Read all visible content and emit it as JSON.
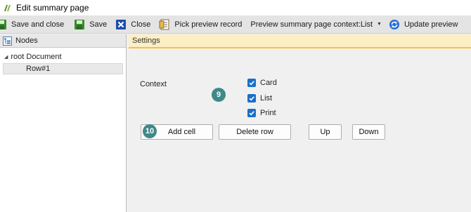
{
  "window": {
    "title": "Edit summary page"
  },
  "toolbar": {
    "save_and_close": "Save and close",
    "save": "Save",
    "close": "Close",
    "pick_preview_record": "Pick preview record",
    "preview_context": "Preview summary page context:List",
    "update_preview": "Update preview"
  },
  "nodes": {
    "header": "Nodes",
    "root_label": "root Document",
    "child_label": "Row#1"
  },
  "settings": {
    "header": "Settings",
    "context_label": "Context",
    "checkboxes": [
      {
        "label": "Card",
        "checked": true
      },
      {
        "label": "List",
        "checked": true
      },
      {
        "label": "Print",
        "checked": true
      }
    ],
    "buttons": {
      "add_cell": "Add cell",
      "delete_row": "Delete row",
      "up": "Up",
      "down": "Down"
    }
  },
  "markers": {
    "m9": "9",
    "m10": "10"
  },
  "colors": {
    "checkbox_blue": "#1a6fc9",
    "marker_teal": "#3e8a89",
    "settings_header_bg": "#fcefc4",
    "settings_header_accent": "#f5c242"
  }
}
